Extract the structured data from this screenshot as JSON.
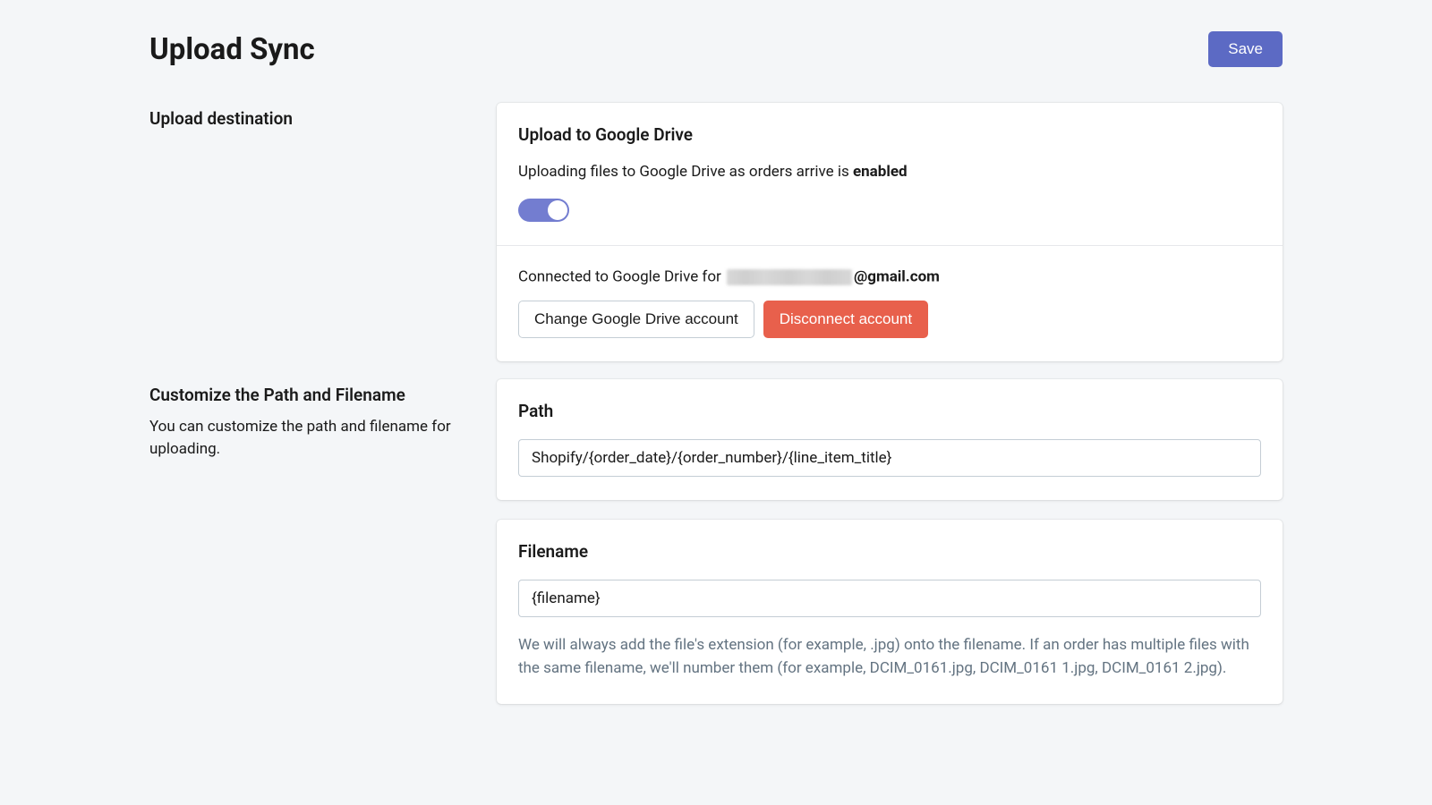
{
  "header": {
    "title": "Upload Sync",
    "save_label": "Save"
  },
  "destination": {
    "left_title": "Upload destination",
    "card_title": "Upload to Google Drive",
    "status_prefix": "Uploading files to Google Drive as orders arrive is ",
    "status_value": "enabled",
    "toggle_on": true,
    "connected_prefix": "Connected to Google Drive for ",
    "connected_email_masked": "[redacted]",
    "connected_email_domain": "@gmail.com",
    "change_account_label": "Change Google Drive account",
    "disconnect_label": "Disconnect account"
  },
  "customize": {
    "left_title": "Customize the Path and Filename",
    "left_desc": "You can customize the path and filename for uploading.",
    "path_title": "Path",
    "path_value": "Shopify/{order_date}/{order_number}/{line_item_title}",
    "filename_title": "Filename",
    "filename_value": "{filename}",
    "filename_help": "We will always add the file's extension (for example, .jpg) onto the filename. If an order has multiple files with the same filename, we'll number them (for example, DCIM_0161.jpg, DCIM_0161 1.jpg, DCIM_0161 2.jpg)."
  }
}
